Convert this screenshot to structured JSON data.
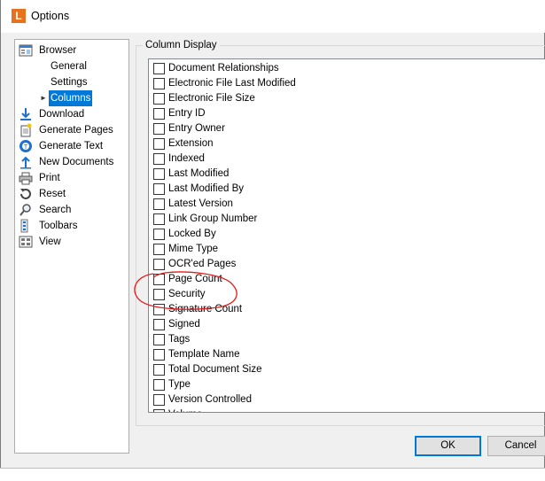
{
  "window": {
    "title": "Options",
    "app_icon_letter": "L"
  },
  "tree": {
    "items": [
      {
        "label": "Browser",
        "icon": "browser-icon",
        "level": 0
      },
      {
        "label": "General",
        "icon": "",
        "level": 1
      },
      {
        "label": "Settings",
        "icon": "",
        "level": 1
      },
      {
        "label": "Columns",
        "icon": "",
        "level": 1,
        "selected": true,
        "expander": "►"
      },
      {
        "label": "Download",
        "icon": "download-icon",
        "level": 0
      },
      {
        "label": "Generate Pages",
        "icon": "generate-pages-icon",
        "level": 0
      },
      {
        "label": "Generate Text",
        "icon": "generate-text-icon",
        "level": 0
      },
      {
        "label": "New Documents",
        "icon": "new-documents-icon",
        "level": 0
      },
      {
        "label": "Print",
        "icon": "print-icon",
        "level": 0
      },
      {
        "label": "Reset",
        "icon": "reset-icon",
        "level": 0
      },
      {
        "label": "Search",
        "icon": "search-icon",
        "level": 0
      },
      {
        "label": "Toolbars",
        "icon": "toolbars-icon",
        "level": 0
      },
      {
        "label": "View",
        "icon": "view-icon",
        "level": 0
      }
    ]
  },
  "column_display": {
    "group_label": "Column Display",
    "items": [
      {
        "label": "Document Relationships",
        "checked": false
      },
      {
        "label": "Electronic File Last Modified",
        "checked": false
      },
      {
        "label": "Electronic File Size",
        "checked": false
      },
      {
        "label": "Entry ID",
        "checked": false
      },
      {
        "label": "Entry Owner",
        "checked": false
      },
      {
        "label": "Extension",
        "checked": false
      },
      {
        "label": "Indexed",
        "checked": false
      },
      {
        "label": "Last Modified",
        "checked": false
      },
      {
        "label": "Last Modified By",
        "checked": false
      },
      {
        "label": "Latest Version",
        "checked": false
      },
      {
        "label": "Link Group Number",
        "checked": false
      },
      {
        "label": "Locked By",
        "checked": false
      },
      {
        "label": "Mime Type",
        "checked": false
      },
      {
        "label": "OCR'ed Pages",
        "checked": false
      },
      {
        "label": "Page Count",
        "checked": false
      },
      {
        "label": "Security",
        "checked": false
      },
      {
        "label": "Signature Count",
        "checked": false
      },
      {
        "label": "Signed",
        "checked": false
      },
      {
        "label": "Tags",
        "checked": false
      },
      {
        "label": "Template Name",
        "checked": false
      },
      {
        "label": "Total Document Size",
        "checked": false
      },
      {
        "label": "Type",
        "checked": false
      },
      {
        "label": "Version Controlled",
        "checked": false
      },
      {
        "label": "Volume",
        "checked": false
      }
    ]
  },
  "buttons": {
    "ok": "OK",
    "cancel": "Cancel"
  },
  "colors": {
    "selection": "#0078d7",
    "annotation": "#e31b1b",
    "app_icon": "#e8711b"
  }
}
